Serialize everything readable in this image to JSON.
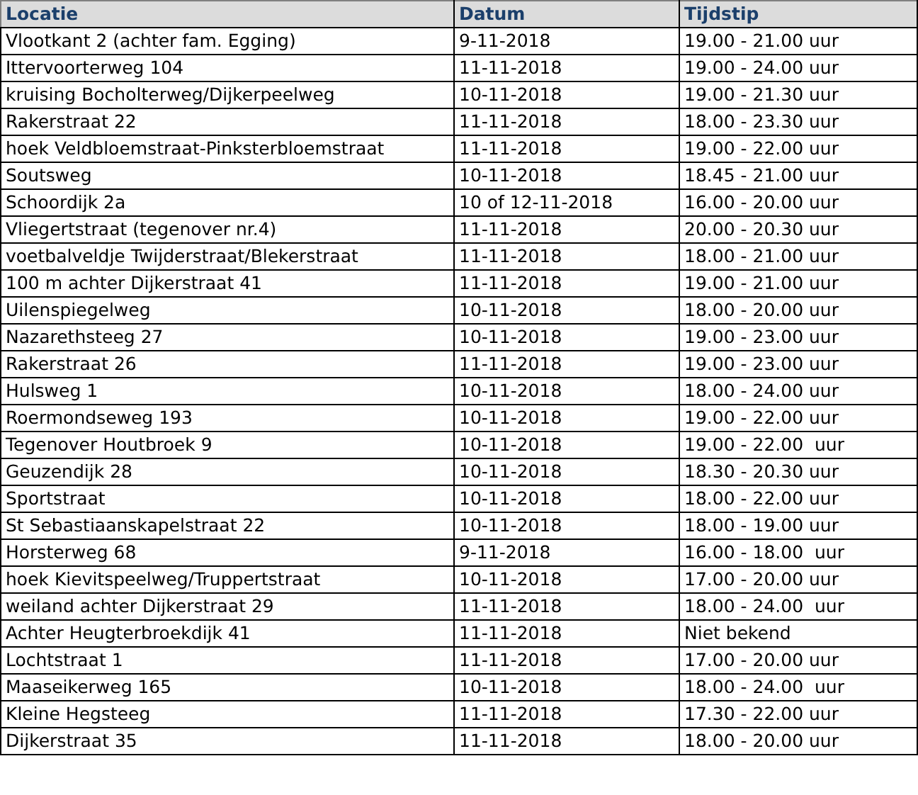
{
  "table": {
    "columns": [
      "Locatie",
      "Datum",
      "Tijdstip"
    ],
    "rows": [
      [
        "Vlootkant 2 (achter fam. Egging)",
        "9-11-2018",
        "19.00 - 21.00 uur"
      ],
      [
        "Ittervoorterweg 104",
        "11-11-2018",
        "19.00 - 24.00 uur"
      ],
      [
        "kruising Bocholterweg/Dijkerpeelweg",
        "10-11-2018",
        "19.00 - 21.30 uur"
      ],
      [
        "Rakerstraat 22",
        "11-11-2018",
        "18.00 - 23.30 uur"
      ],
      [
        "hoek Veldbloemstraat-Pinksterbloemstraat",
        "11-11-2018",
        "19.00 - 22.00 uur"
      ],
      [
        "Soutsweg",
        "10-11-2018",
        "18.45 - 21.00 uur"
      ],
      [
        "Schoordijk 2a",
        "10 of 12-11-2018",
        "16.00 - 20.00 uur"
      ],
      [
        "Vliegertstraat (tegenover nr.4)",
        "11-11-2018",
        "20.00 - 20.30 uur"
      ],
      [
        "voetbalveldje Twijderstraat/Blekerstraat",
        "11-11-2018",
        "18.00 - 21.00 uur"
      ],
      [
        "100 m achter Dijkerstraat 41",
        "11-11-2018",
        "19.00 - 21.00 uur"
      ],
      [
        "Uilenspiegelweg",
        "10-11-2018",
        "18.00 - 20.00 uur"
      ],
      [
        "Nazarethsteeg 27",
        "10-11-2018",
        "19.00 - 23.00 uur"
      ],
      [
        "Rakerstraat 26",
        "11-11-2018",
        "19.00 - 23.00 uur"
      ],
      [
        "Hulsweg 1",
        "10-11-2018",
        "18.00 - 24.00 uur"
      ],
      [
        "Roermondseweg 193",
        "10-11-2018",
        "19.00 - 22.00 uur"
      ],
      [
        "Tegenover Houtbroek 9",
        "10-11-2018",
        "19.00 - 22.00  uur"
      ],
      [
        "Geuzendijk 28",
        "10-11-2018",
        "18.30 - 20.30 uur"
      ],
      [
        "Sportstraat",
        "10-11-2018",
        "18.00 - 22.00 uur"
      ],
      [
        "St Sebastiaanskapelstraat 22",
        "10-11-2018",
        "18.00 - 19.00 uur"
      ],
      [
        "Horsterweg 68",
        "9-11-2018",
        "16.00 - 18.00  uur"
      ],
      [
        "hoek Kievitspeelweg/Truppertstraat",
        "10-11-2018",
        "17.00 - 20.00 uur"
      ],
      [
        "weiland achter Dijkerstraat 29",
        "11-11-2018",
        "18.00 - 24.00  uur"
      ],
      [
        "Achter Heugterbroekdijk 41",
        "11-11-2018",
        "Niet bekend"
      ],
      [
        "Lochtstraat 1",
        "11-11-2018",
        "17.00 - 20.00 uur"
      ],
      [
        "Maaseikerweg 165",
        "10-11-2018",
        "18.00 - 24.00  uur"
      ],
      [
        "Kleine Hegsteeg",
        "11-11-2018",
        "17.30 - 22.00 uur"
      ],
      [
        "Dijkerstraat 35",
        "11-11-2018",
        "18.00 - 20.00 uur"
      ]
    ]
  }
}
